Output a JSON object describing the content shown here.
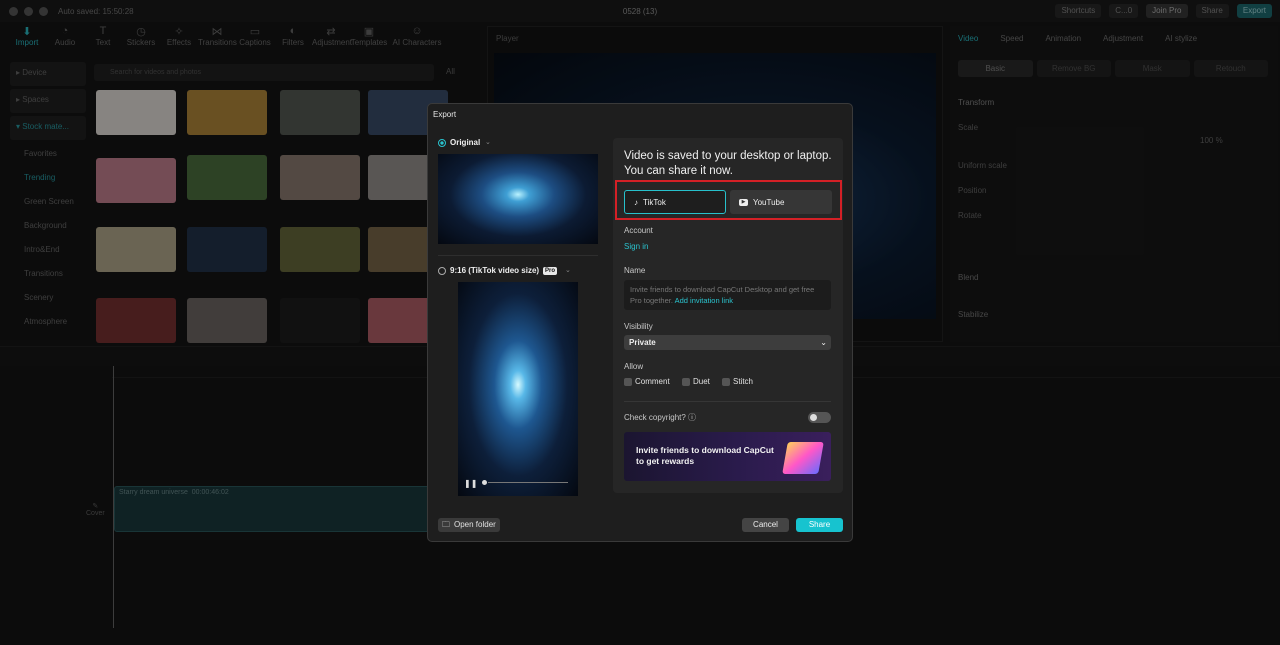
{
  "window": {
    "title": "0528 (13)",
    "autosave": "Auto saved: 15:50:28"
  },
  "titlebar": {
    "shortcuts": "Shortcuts",
    "user": "C...0",
    "join_pro": "Join Pro",
    "share": "Share",
    "export": "Export"
  },
  "toolbar": {
    "items": [
      "Import",
      "Audio",
      "Text",
      "Stickers",
      "Effects",
      "Transitions",
      "Captions",
      "Filters",
      "Adjustment",
      "Templates",
      "AI Characters"
    ]
  },
  "left_nav": {
    "device": "Device",
    "spaces": "Spaces",
    "stock": "Stock mate...",
    "items": [
      "Favorites",
      "Trending",
      "Green Screen",
      "Background",
      "Intro&End",
      "Transitions",
      "Scenery",
      "Atmosphere"
    ]
  },
  "search": {
    "placeholder": "Search for videos and photos",
    "all": "All"
  },
  "player": {
    "label": "Player"
  },
  "right_panel": {
    "tabs": [
      "Video",
      "Speed",
      "Animation",
      "Adjustment",
      "AI stylize"
    ],
    "sub_tabs": [
      "Basic",
      "Remove BG",
      "Mask",
      "Retouch"
    ],
    "transform": "Transform",
    "scale": "Scale",
    "scale_value": "100 %",
    "uniform_scale": "Uniform scale",
    "position": "Position",
    "rotate": "Rotate",
    "blend": "Blend",
    "stabilize": "Stabilize"
  },
  "timeline": {
    "clip_title": "Starry dream universe",
    "clip_duration": "00:00:46:02",
    "cover": "Cover"
  },
  "dialog": {
    "title": "Export",
    "original_label": "Original",
    "tiktok_size_label": "9:16 (TikTok video size)",
    "pro_badge": "Pro",
    "headline": "Video is saved to your desktop or laptop. You can share it now.",
    "platforms": [
      {
        "label": "TikTok",
        "selected": true
      },
      {
        "label": "YouTube",
        "selected": false
      }
    ],
    "account_label": "Account",
    "sign_in": "Sign in",
    "name_label": "Name",
    "name_text": "Invite friends to download CapCut Desktop and get free Pro together.",
    "name_link": "Add invitation link",
    "visibility_label": "Visibility",
    "visibility_value": "Private",
    "allow_label": "Allow",
    "allow_options": [
      "Comment",
      "Duet",
      "Stitch"
    ],
    "copyright_label": "Check copyright?",
    "banner_text": "Invite friends to download CapCut to get rewards",
    "open_folder": "Open folder",
    "cancel": "Cancel",
    "share": "Share"
  }
}
